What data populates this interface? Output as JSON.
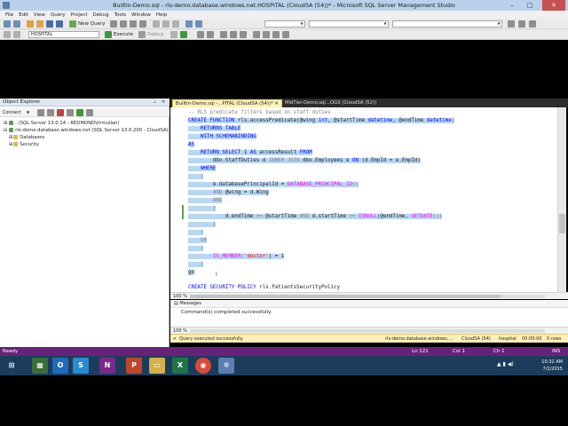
{
  "window": {
    "title": "Builtin-Demo.sql - rls-demo.database.windows.net.HOSPITAL (CloudSA (54))* - Microsoft SQL Server Management Studio",
    "min": "–",
    "max": "□",
    "close": "✕"
  },
  "menu": [
    "File",
    "Edit",
    "View",
    "Query",
    "Project",
    "Debug",
    "Tools",
    "Window",
    "Help"
  ],
  "toolbar": {
    "new_query": "New Query",
    "database": "HOSPITAL",
    "execute": "Execute",
    "debug": "Debug"
  },
  "object_explorer": {
    "title": "Object Explorer",
    "connect": "Connect",
    "tree": [
      ". (SQL Server 13.0.14 - REDMOND\\rhmullan)",
      "rls-demo.database.windows.net (SQL Server 13.0.200 - CloudSA)",
      "Databases",
      "Security"
    ]
  },
  "tabs": [
    {
      "label": "Builtin-Demo.sql -...PITAL (CloudSA (54))*"
    },
    {
      "label": "MidTier-Demo.sql...OGS (CloudSA (52))"
    }
  ],
  "code": {
    "l1": "-- RLS predicate filters based on staff duties",
    "l2a": "CREATE FUNCTION",
    "l2b": " rls.accessPredicate(@wing ",
    "l2c": "int",
    "l2d": ", @startTime ",
    "l2e": "datetime",
    "l2f": ", @endTime ",
    "l2g": "datetime",
    "l2h": ")",
    "l3": "RETURNS TABLE",
    "l4": "WITH SCHEMABINDING",
    "l5": "AS",
    "l6a": "RETURN SELECT",
    "l6b": " 1 ",
    "l6c": "AS",
    "l6d": " accessResult ",
    "l6e": "FROM",
    "l7a": "dbo.StaffDuties d ",
    "l7b": "INNER JOIN",
    "l7c": " dbo.Employees e ",
    "l7d": "ON",
    "l7e": " (d.EmpId = e.EmpId)",
    "l8": "WHERE",
    "l9": "(",
    "l10a": "e.databasePrincipalId = ",
    "l10b": "DATABASE_PRINCIPAL_ID",
    "l10c": "()",
    "l11a": "AND",
    "l11b": " @wing = d.Wing",
    "l12": "AND",
    "l13": "(",
    "l14a": "d.endTime ",
    "l14b": ">=",
    "l14c": " @startTime ",
    "l14d": "AND",
    "l14e": " d.startTime ",
    "l14f": "<=",
    "l14g": " ",
    "l14h": "ISNULL",
    "l14i": "(@endTime, ",
    "l14j": "GETDATE",
    "l14k": "())",
    "l15": ")",
    "l16": ")",
    "l17": "OR",
    "l18": "(",
    "l19a": "IS_MEMBER",
    "l19b": "(",
    "l19c": "'doctor'",
    "l19d": ") = 1",
    "l20": ")",
    "l21": "go",
    "l22a": "CREATE SECURITY POLICY",
    "l22b": " rls.PatientsSecurityPolicy"
  },
  "zoom": "100 %",
  "messages": {
    "tab": "Messages",
    "text": "Command(s) completed successfully."
  },
  "query_status": {
    "status": "Query executed successfully.",
    "server": "rls-demo.database.windows....",
    "user": "CloudSA (54)",
    "db": "hospital",
    "time": "00:00:00",
    "rows": "0 rows"
  },
  "status_bar": {
    "ready": "Ready",
    "ln": "Ln 121",
    "col": "Col 1",
    "ch": "Ch 1",
    "ins": "INS"
  },
  "taskbar": {
    "time": "10:32 AM",
    "date": "7/2/2015"
  },
  "colors": {
    "accent_purple": "#68217a",
    "selection": "#b9d7f5",
    "keyword": "#0000ff",
    "function": "#ff00ff",
    "string": "#ff0000"
  }
}
